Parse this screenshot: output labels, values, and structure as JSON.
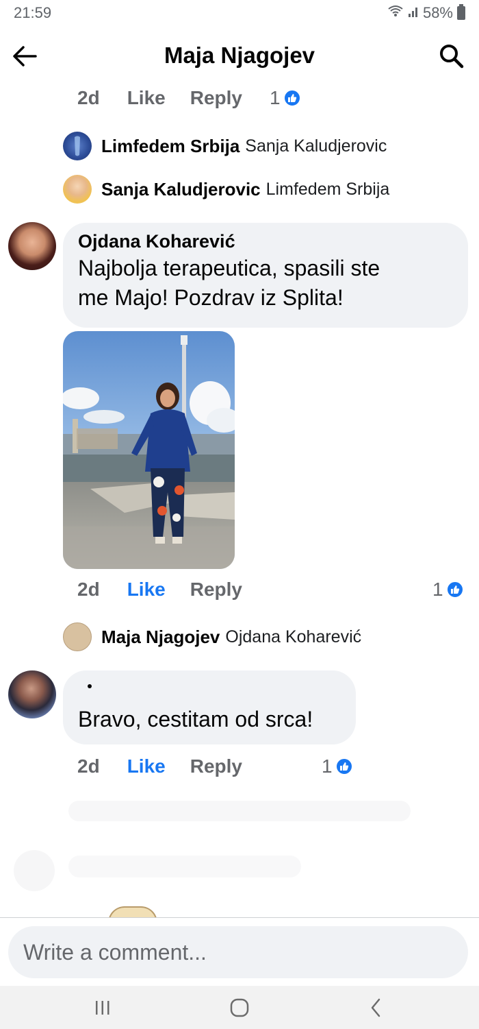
{
  "status": {
    "time": "21:59",
    "battery": "58%"
  },
  "header": {
    "title": "Maja Njagojev"
  },
  "top_actions": {
    "time": "2d",
    "like": "Like",
    "reply": "Reply",
    "count": "1"
  },
  "mini_replies_1": [
    {
      "name": "Limfedem Srbija",
      "text": "Sanja Kaludjerovic"
    },
    {
      "name": "Sanja Kaludjerovic",
      "text": "Limfedem Srbija"
    }
  ],
  "comment_1": {
    "author": "Ojdana Koharević",
    "text_line1": "Najbolja terapeutica, spasili ste",
    "text_line2": "me Majo! Pozdrav iz Splita!",
    "time": "2d",
    "like": "Like",
    "reply": "Reply",
    "count": "1"
  },
  "mini_reply_2": {
    "name": "Maja Njagojev",
    "text": "Ojdana Koharević"
  },
  "comment_2": {
    "author": "",
    "text": "Bravo, cestitam od srca!",
    "time": "2d",
    "like": "Like",
    "reply": "Reply",
    "count": "1"
  },
  "composer": {
    "placeholder": "Write a comment..."
  },
  "colors": {
    "accent": "#1877f2",
    "bubble": "#f0f2f5",
    "muted": "#65676b"
  }
}
